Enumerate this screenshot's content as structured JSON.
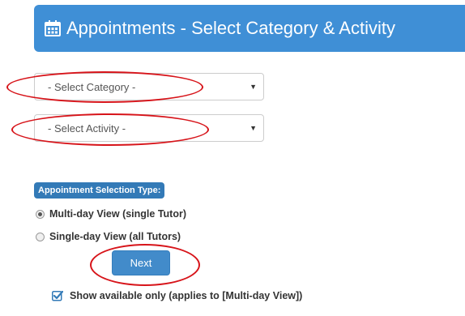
{
  "header": {
    "icon": "calendar-icon",
    "title": "Appointments - Select Category & Activity",
    "color": "#3f8fd6"
  },
  "category_select": {
    "value": "- Select Category -",
    "caret": "▼"
  },
  "activity_select": {
    "value": "- Select Activity -",
    "caret": "▼"
  },
  "selection_type": {
    "badge_label": "Appointment Selection Type:",
    "options": [
      {
        "label": "Multi-day View (single Tutor)",
        "checked": true
      },
      {
        "label": "Single-day View (all Tutors)",
        "checked": false
      }
    ]
  },
  "next_button": {
    "label": "Next",
    "color": "#428bca"
  },
  "show_available": {
    "label": "Show available only (applies to [Multi-day View])",
    "checked": true
  },
  "annotation_color": "#d7141a"
}
